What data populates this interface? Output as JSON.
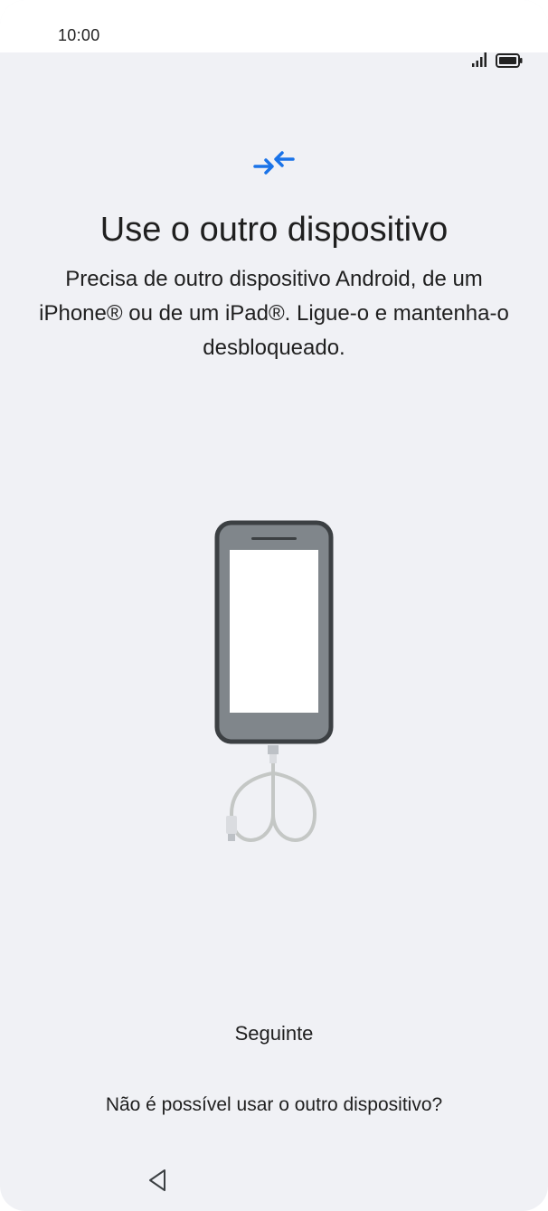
{
  "status_bar": {
    "time": "10:00",
    "icons": [
      "signal-icon",
      "battery-icon"
    ]
  },
  "header": {
    "icon": "transfer-arrows-icon",
    "title": "Use o outro dispositivo",
    "description": "Precisa de outro dispositivo Android, de um iPhone® ou de um iPad®. Ligue-o e mantenha-o desbloqueado."
  },
  "illustration": {
    "icon": "phone-with-cable-illustration"
  },
  "actions": {
    "next_label": "Seguinte",
    "alternate_label": "Não é possível usar o outro dispositivo?"
  },
  "nav_bar": {
    "back_icon": "back-triangle-icon"
  },
  "colors": {
    "background": "#f0f1f5",
    "accent": "#1a73e8",
    "text": "#1f1f1f"
  }
}
